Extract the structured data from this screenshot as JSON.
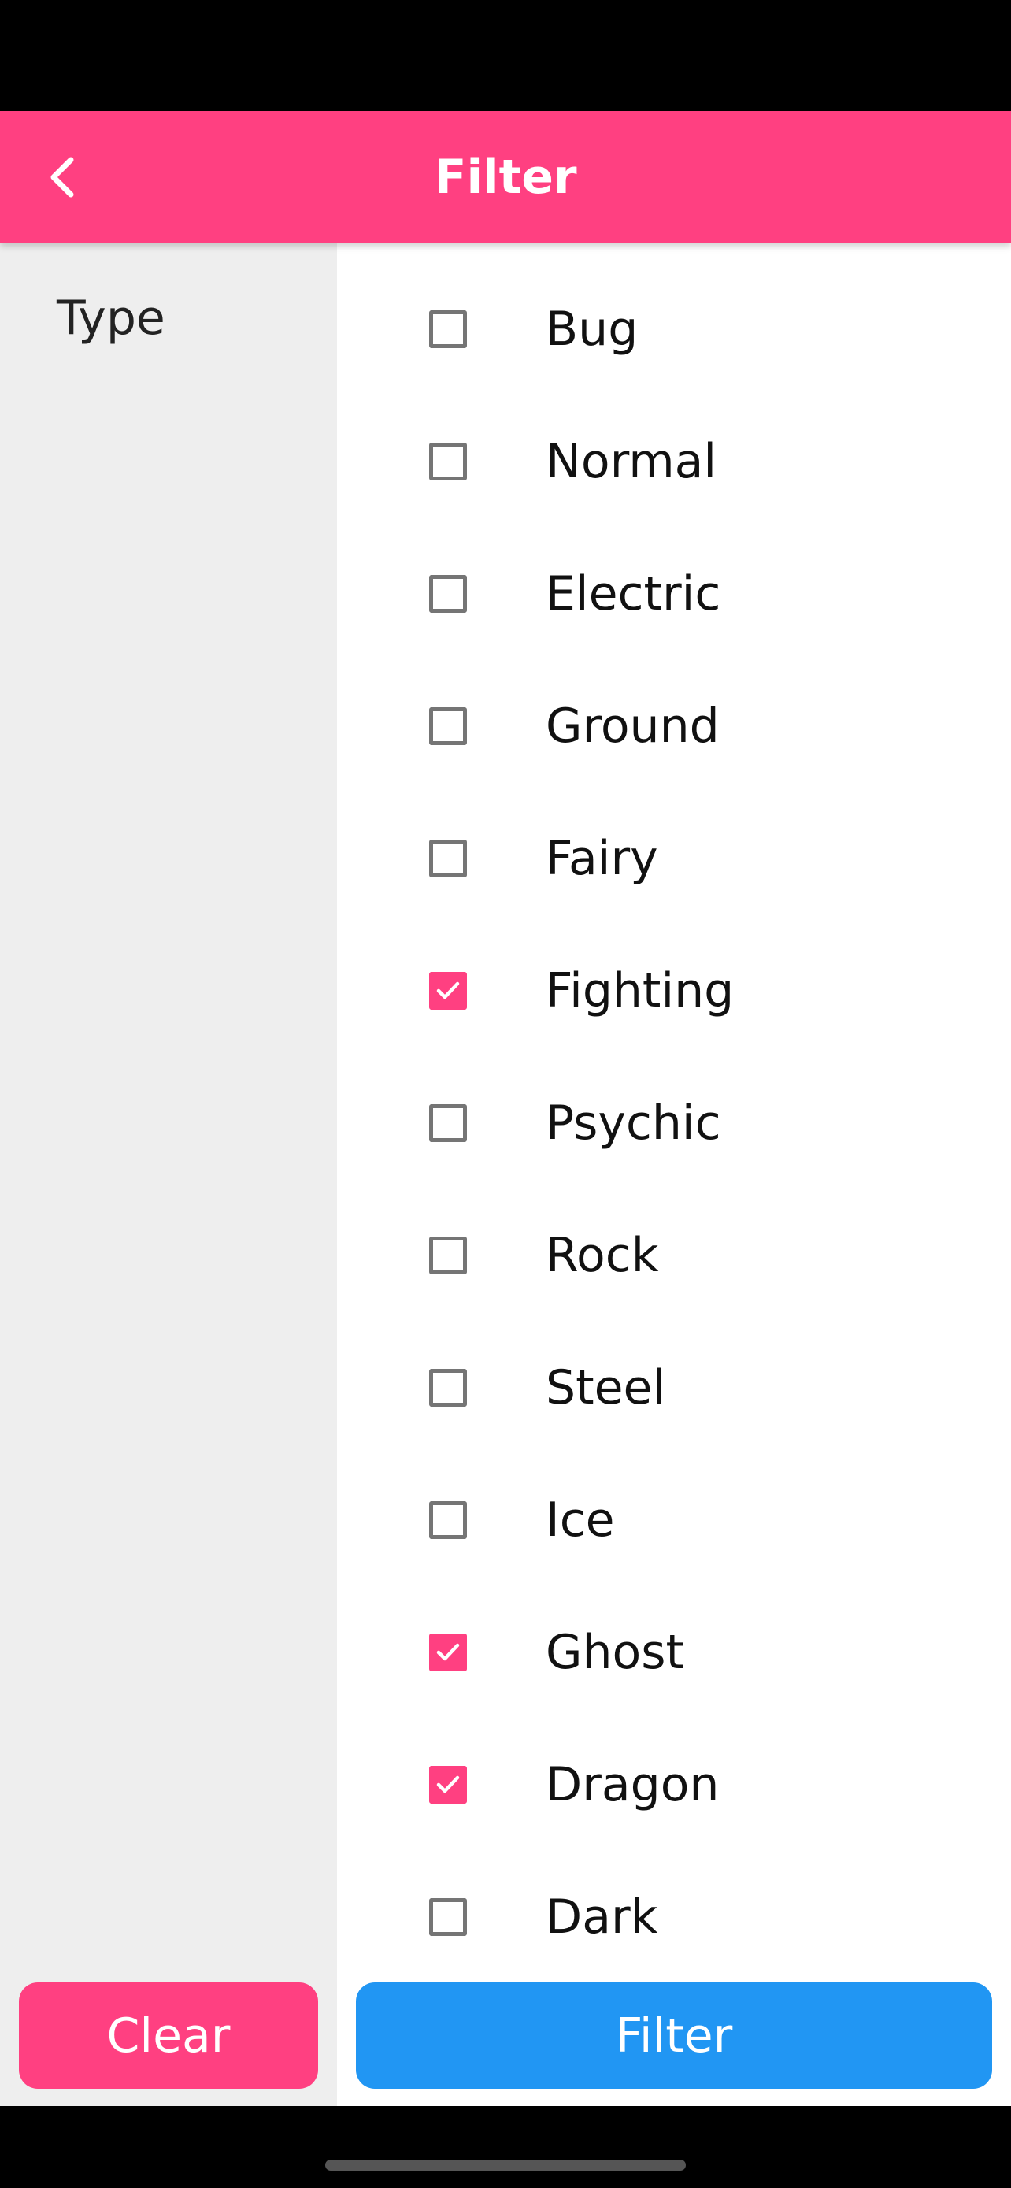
{
  "header": {
    "title": "Filter"
  },
  "sidebar": {
    "category": "Type"
  },
  "options": [
    {
      "label": "Bug",
      "checked": false
    },
    {
      "label": "Normal",
      "checked": false
    },
    {
      "label": "Electric",
      "checked": false
    },
    {
      "label": "Ground",
      "checked": false
    },
    {
      "label": "Fairy",
      "checked": false
    },
    {
      "label": "Fighting",
      "checked": true
    },
    {
      "label": "Psychic",
      "checked": false
    },
    {
      "label": "Rock",
      "checked": false
    },
    {
      "label": "Steel",
      "checked": false
    },
    {
      "label": "Ice",
      "checked": false
    },
    {
      "label": "Ghost",
      "checked": true
    },
    {
      "label": "Dragon",
      "checked": true
    },
    {
      "label": "Dark",
      "checked": false
    }
  ],
  "buttons": {
    "clear": "Clear",
    "filter": "Filter"
  },
  "colors": {
    "accent": "#ff4081",
    "primary_button": "#2196f3",
    "sidebar_bg": "#eeeeee"
  }
}
